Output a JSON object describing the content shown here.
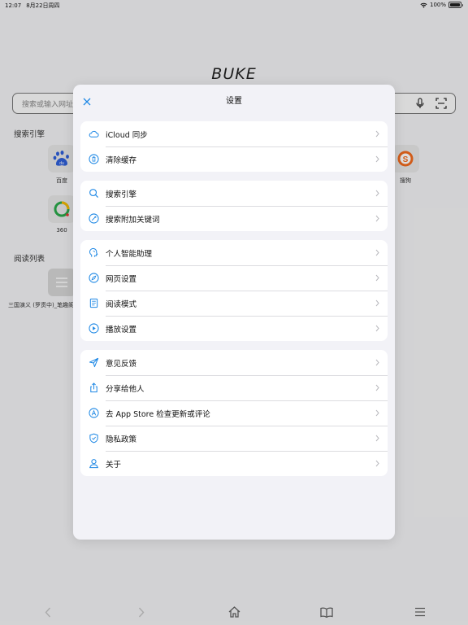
{
  "status": {
    "time": "12:07",
    "date": "8月22日周四",
    "battery": "100%"
  },
  "home": {
    "app_title": "BUKE",
    "search_placeholder": "搜索或输入网址",
    "engines_label": "搜索引擎",
    "engines": [
      {
        "name": "百度",
        "icon": "baidu-icon"
      },
      {
        "name": "360",
        "icon": "360-icon"
      },
      {
        "name": "搜狗",
        "icon": "sogou-icon"
      }
    ],
    "reading_label": "阅读列表",
    "reading_items": [
      {
        "title": "三国演义 (罗贯中)_笔趣阁"
      }
    ]
  },
  "settings": {
    "title": "设置",
    "groups": [
      {
        "items": [
          {
            "label": "iCloud 同步",
            "icon": "cloud-icon"
          },
          {
            "label": "清除缓存",
            "icon": "trash-icon"
          }
        ]
      },
      {
        "items": [
          {
            "label": "搜索引擎",
            "icon": "search-icon"
          },
          {
            "label": "搜索附加关键词",
            "icon": "tag-icon"
          }
        ]
      },
      {
        "items": [
          {
            "label": "个人智能助理",
            "icon": "brain-icon"
          },
          {
            "label": "网页设置",
            "icon": "compass-icon"
          },
          {
            "label": "阅读模式",
            "icon": "document-icon"
          },
          {
            "label": "播放设置",
            "icon": "play-icon"
          }
        ]
      },
      {
        "items": [
          {
            "label": "意见反馈",
            "icon": "paper-plane-icon"
          },
          {
            "label": "分享给他人",
            "icon": "share-icon"
          },
          {
            "label": "去 App Store 检查更新或评论",
            "icon": "app-store-icon"
          },
          {
            "label": "隐私政策",
            "icon": "shield-check-icon"
          },
          {
            "label": "关于",
            "icon": "person-icon"
          }
        ]
      }
    ]
  },
  "toolbar": {
    "icons": [
      "back-icon",
      "forward-icon",
      "home-icon",
      "book-icon",
      "menu-icon"
    ]
  },
  "colors": {
    "accent": "#1e88e5",
    "sheet_bg": "#f2f2f7",
    "row_bg": "#ffffff"
  }
}
